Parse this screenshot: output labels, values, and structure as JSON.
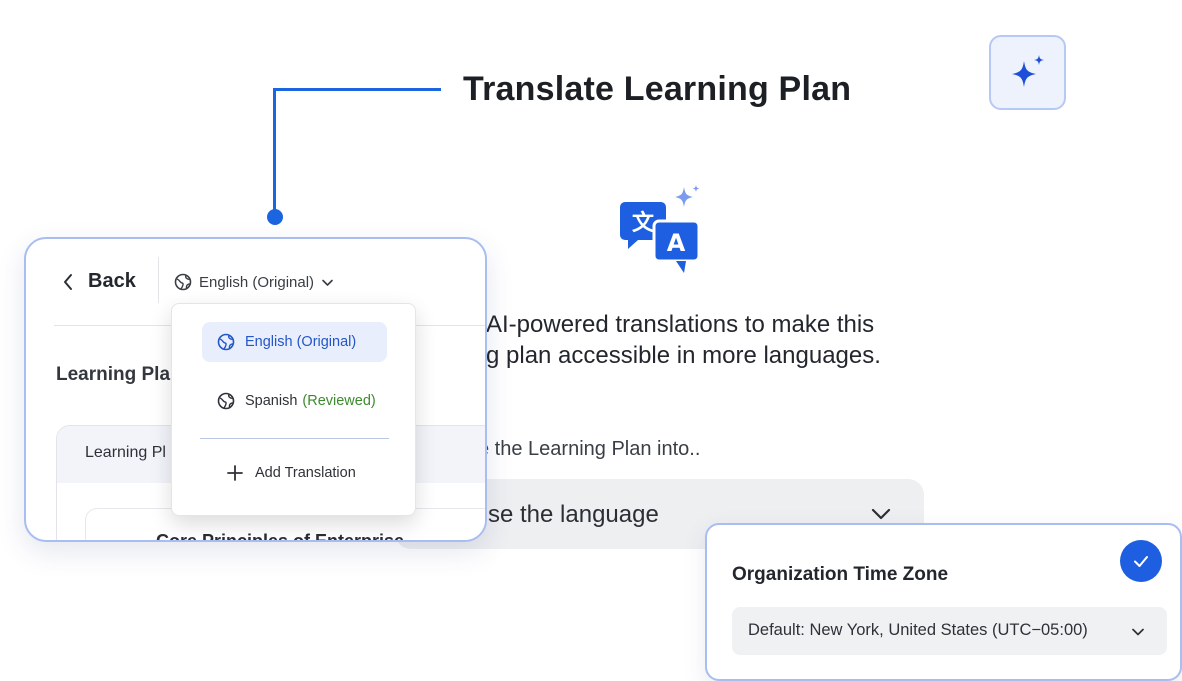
{
  "heading": "Translate Learning Plan",
  "description": {
    "line1": "AI-powered translations to make this",
    "line2": "g plan accessible in more languages."
  },
  "translate_into_label": "e the Learning Plan into..",
  "language_select": {
    "placeholder": "se the language"
  },
  "panel": {
    "back_label": "Back",
    "current_language": "English (Original)",
    "section_title": "Learning Pla",
    "card_header": "Learning Pl",
    "card_item_title": "Core Principles of Enterprise"
  },
  "language_menu": {
    "items": [
      {
        "label": "English (Original)",
        "status": "",
        "selected": true
      },
      {
        "label": "Spanish",
        "status": "(Reviewed)",
        "selected": false
      }
    ],
    "add_label": "Add Translation"
  },
  "timezone": {
    "title": "Organization Time Zone",
    "value": "Default: New York, United States (UTC−05:00)",
    "confirmed": true
  },
  "colors": {
    "accent": "#1b66e0",
    "card_border": "#a8bdf0",
    "reviewed_green": "#3d8a2e",
    "selected_bg": "#e8eefc"
  },
  "icons": [
    "sparkle-icon",
    "translate-icon",
    "chevron-left-icon",
    "globe-icon",
    "chevron-down-icon",
    "plus-icon",
    "check-icon"
  ]
}
